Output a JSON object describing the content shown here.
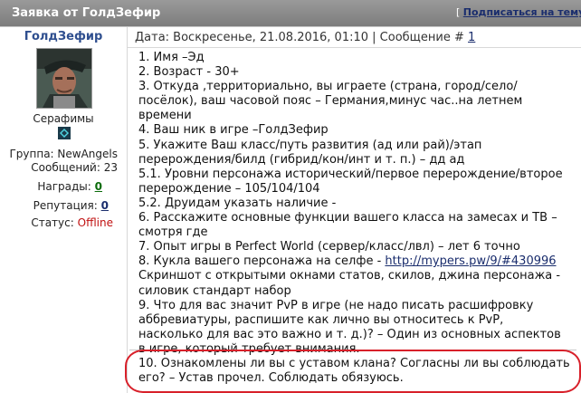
{
  "header": {
    "title": "Заявка от ГолдЗефир",
    "subscribe_prefix": "[",
    "subscribe_label": "Подписаться на тему",
    "subscribe_suffix": "]"
  },
  "author": {
    "name": "ГолдЗефир",
    "rank_title": "Серафимы",
    "group_label": "Группа:",
    "group": "NewAngels",
    "posts_label": "Сообщений:",
    "posts": "23",
    "awards_label": "Награды:",
    "awards": "0",
    "rep_label": "Репутация:",
    "rep": "0",
    "status_label": "Статус:",
    "status": "Offline"
  },
  "post": {
    "meta": "Дата: Воскресенье, 21.08.2016, 01:10 | Сообщение #",
    "number": "1",
    "lines": [
      "1. Имя –Эд",
      "2. Возраст - 30+",
      "3. Откуда ,территориально, вы играете (страна, город/село/",
      "посёлок), ваш часовой пояс – Германия,минус час..на летнем",
      "времени",
      "4. Ваш ник в игре –ГолдЗефир",
      "5. Укажите Ваш класс/путь развития (ад или рай)/этап",
      "перерождения/билд (гибрид/кон/инт и т. п.) – дд ад",
      "5.1. Уровни персонажа исторический/первое перерождение/второе",
      "перерождение – 105/104/104",
      "5.2. Друидам указать наличие -",
      "6. Расскажите основные функции вашего класса на замесах и ТВ –",
      "смотря где",
      "7. Опыт игры в Perfect World (сервер/класс/лвл) – лет 6 точно"
    ],
    "line8_prefix": "8. Кукла вашего персонажа на селфе - ",
    "line8_link": "http://mypers.pw/9/#430996",
    "lines2": [
      "Скриншот с открытыми окнами статов, скилов, джина персонажа -",
      "силовик стандарт набор",
      "9. Что для вас значит PvP в игре (не надо писать расшифровку",
      "аббревиатуры, распишите как лично вы относитесь к PvP,",
      "насколько для вас это важно и т. д.)? – Один из основных аспектов",
      "в игре, который требует внимания.",
      "10. Ознакомлены ли вы с уставом клана? Согласны ли вы соблюдать",
      "его? – Устав прочел. Соблюдать обязуюсь."
    ]
  },
  "colors": {
    "highlight": "#d8202a",
    "status_offline": "#c01010",
    "link_green": "#0a6b0a"
  }
}
